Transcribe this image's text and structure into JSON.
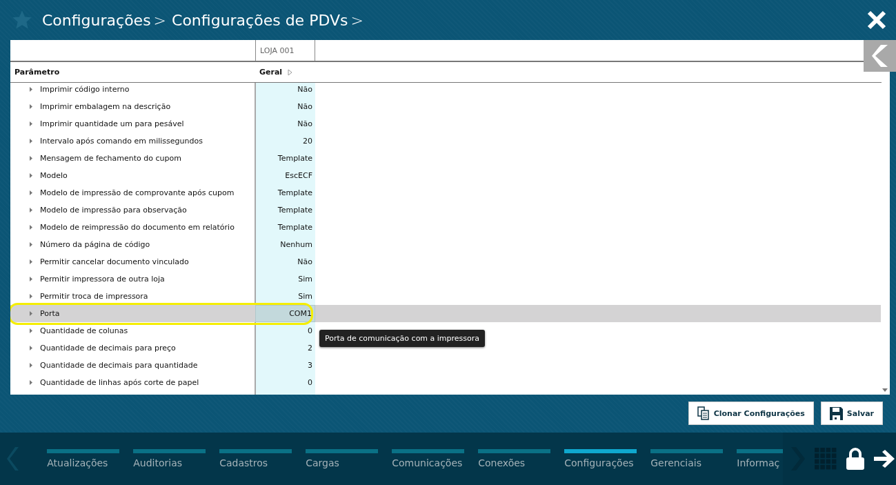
{
  "header": {
    "breadcrumbs": [
      "Configurações",
      "Configurações de PDVs"
    ],
    "separators": [
      ">",
      ">"
    ]
  },
  "table": {
    "group_header": "LOJA 001",
    "columns": [
      "Parâmetro",
      "Geral"
    ],
    "rows": [
      {
        "name": "Imprimir código interno",
        "value": "Não",
        "selected": false
      },
      {
        "name": "Imprimir embalagem na descrição",
        "value": "Não",
        "selected": false
      },
      {
        "name": "Imprimir quantidade um para pesável",
        "value": "Não",
        "selected": false
      },
      {
        "name": "Intervalo após comando em milissegundos",
        "value": "20",
        "selected": false
      },
      {
        "name": "Mensagem de fechamento do cupom",
        "value": "Template",
        "selected": false
      },
      {
        "name": "Modelo",
        "value": "EscECF",
        "selected": false
      },
      {
        "name": "Modelo de impressão de comprovante após cupom",
        "value": "Template",
        "selected": false
      },
      {
        "name": "Modelo de impressão para observação",
        "value": "Template",
        "selected": false
      },
      {
        "name": "Modelo de reimpressão do documento em relatório",
        "value": "Template",
        "selected": false
      },
      {
        "name": "Número da página de código",
        "value": "Nenhum",
        "selected": false
      },
      {
        "name": "Permitir cancelar documento vinculado",
        "value": "Não",
        "selected": false
      },
      {
        "name": "Permitir impressora de outra loja",
        "value": "Sim",
        "selected": false
      },
      {
        "name": "Permitir troca de impressora",
        "value": "Sim",
        "selected": false
      },
      {
        "name": "Porta",
        "value": "COM1",
        "selected": true
      },
      {
        "name": "Quantidade de colunas",
        "value": "0",
        "selected": false
      },
      {
        "name": "Quantidade de decimais para preço",
        "value": "2",
        "selected": false
      },
      {
        "name": "Quantidade de decimais para quantidade",
        "value": "3",
        "selected": false
      },
      {
        "name": "Quantidade de linhas após corte de papel",
        "value": "0",
        "selected": false
      }
    ],
    "tooltip": "Porta de comunicação com a impressora"
  },
  "buttons": [
    "Clonar Configurações",
    "Salvar"
  ],
  "nav_tabs": [
    {
      "label": "Atualizações",
      "selected": false
    },
    {
      "label": "Auditorias",
      "selected": false
    },
    {
      "label": "Cadastros",
      "selected": false
    },
    {
      "label": "Cargas",
      "selected": false
    },
    {
      "label": "Comunicações",
      "selected": false
    },
    {
      "label": "Conexões",
      "selected": false
    },
    {
      "label": "Configurações",
      "selected": true
    },
    {
      "label": "Gerenciais",
      "selected": false
    },
    {
      "label": "Informaç",
      "selected": false
    }
  ]
}
